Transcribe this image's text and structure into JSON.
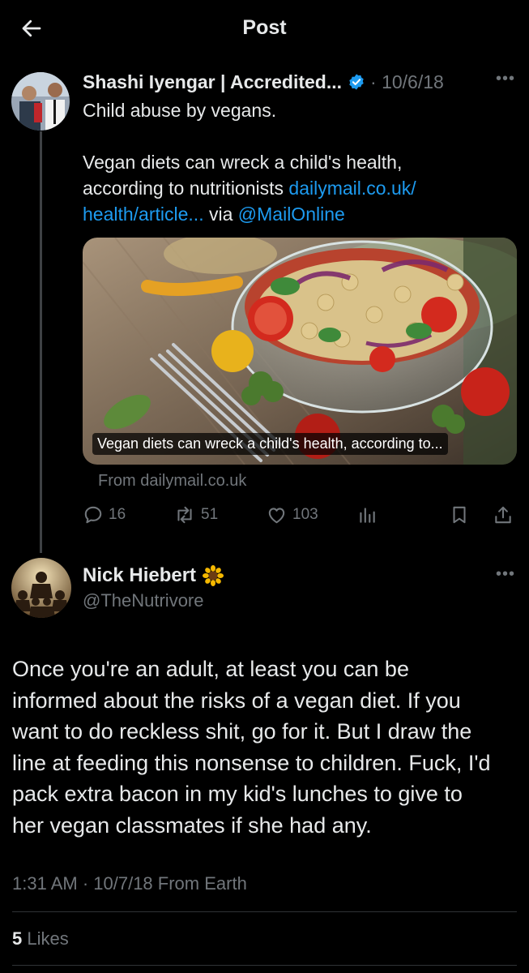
{
  "header": {
    "title": "Post"
  },
  "original_tweet": {
    "author_name": "Shashi Iyengar | Accredited...",
    "date": "· 10/6/18",
    "text_line1": "Child abuse by vegans.",
    "text_line2": "Vegan diets can wreck a child's health,",
    "text_line3_prefix": "according to nutritionists ",
    "link_part1": "dailymail.co.uk/",
    "link_part2": "health/article...",
    "via_text": " via ",
    "mention": "@MailOnline",
    "media_caption": "Vegan diets can wreck a child's health, according to...",
    "from_source": "From dailymail.co.uk",
    "stats": {
      "replies": "16",
      "retweets": "51",
      "likes": "103"
    }
  },
  "reply_tweet": {
    "author_name": "Nick Hiebert",
    "handle": "@TheNutrivore",
    "lines": [
      "Once you're an adult, at least you can be",
      "informed about the risks of a vegan diet. If you",
      "want to do reckless shit, go for it. But I draw the",
      "line at feeding this nonsense to children. Fuck, I'd",
      "pack extra bacon in my kid's lunches to give to",
      "her vegan classmates if she had any."
    ],
    "timestamp": "1:31 AM · 10/7/18 From Earth",
    "likes_count": "5",
    "likes_label": " Likes"
  },
  "icons": {
    "back": "arrow-left-icon",
    "verified": "verified-badge-icon",
    "more": "more-icon",
    "reply": "reply-icon",
    "retweet": "retweet-icon",
    "like": "heart-icon",
    "views": "views-icon",
    "bookmark": "bookmark-icon",
    "share": "share-icon",
    "sunflower": "sunflower-emoji-icon"
  },
  "colors": {
    "background": "#000000",
    "text": "#e7e9ea",
    "muted": "#71767b",
    "link": "#1d9bf0",
    "verified": "#1d9bf0"
  }
}
